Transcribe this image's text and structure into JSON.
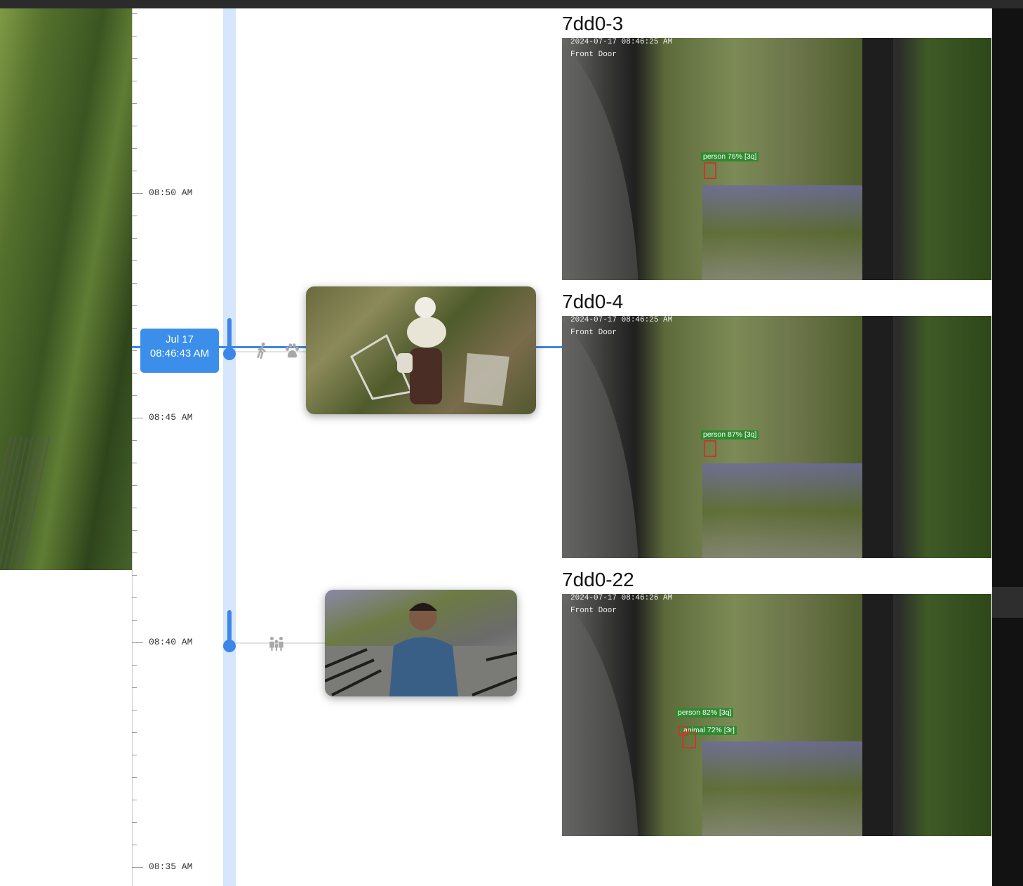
{
  "timeline": {
    "tick_labels": [
      "08:50 AM",
      "08:45 AM",
      "08:40 AM",
      "08:35 AM"
    ],
    "current": {
      "date": "Jul 17",
      "time": "08:46:43 AM"
    },
    "events": [
      {
        "icons": [
          "person-walking-icon",
          "paw-icon"
        ],
        "thumbnail": "event-thumbnail-person-with-dog"
      },
      {
        "icons": [
          "group-icon"
        ],
        "thumbnail": "event-thumbnail-man-on-stairs"
      }
    ]
  },
  "cameras": [
    {
      "title": "7dd0-3",
      "timestamp": "2024-07-17 08:46:25 AM",
      "location": "Front Door",
      "detections": [
        "person 76% [3q]"
      ]
    },
    {
      "title": "7dd0-4",
      "timestamp": "2024-07-17 08:46:25 AM",
      "location": "Front Door",
      "detections": [
        "person 87% [3q]"
      ]
    },
    {
      "title": "7dd0-22",
      "timestamp": "2024-07-17 08:46:26 AM",
      "location": "Front Door",
      "detections": [
        "person 82% [3q]",
        "animal 72% [3r]"
      ]
    }
  ],
  "colors": {
    "accent": "#3b86e6",
    "track": "#d6e6fb",
    "detection_label": "#2f8a2f",
    "detection_box": "#c43a2a"
  }
}
